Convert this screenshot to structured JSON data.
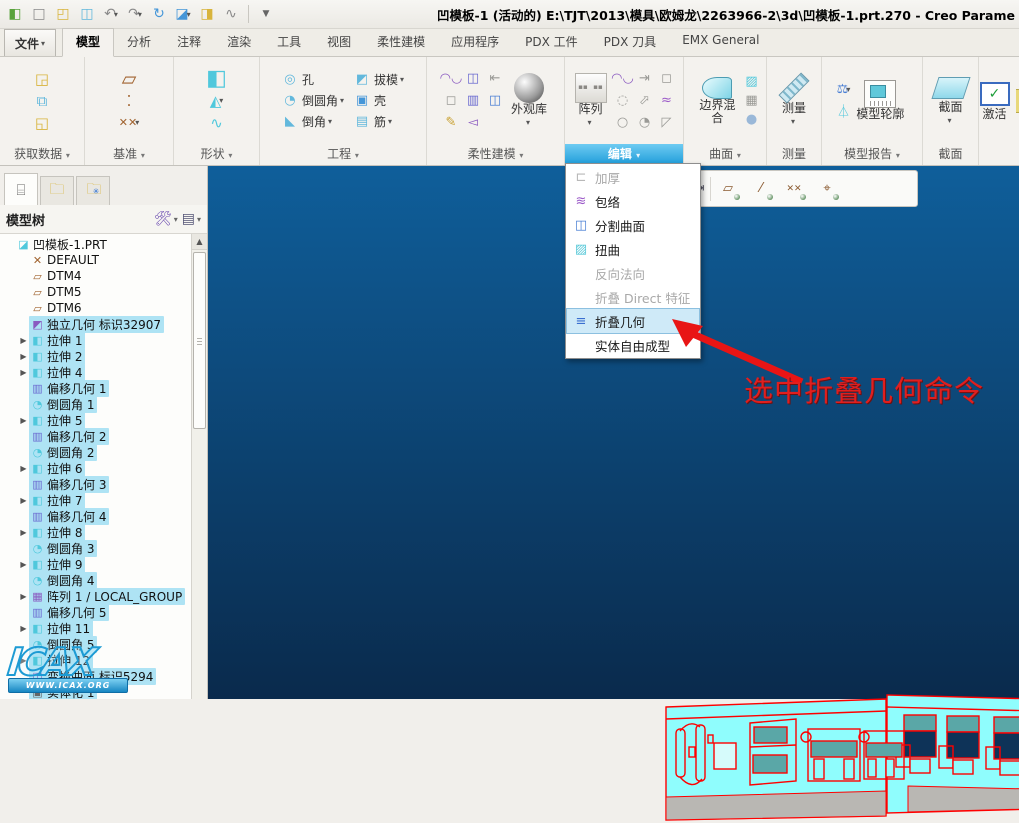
{
  "window": {
    "title": "凹模板-1 (活动的) E:\\TJT\\2013\\模具\\欧姆龙\\2263966-2\\3d\\凹模板-1.prt.270 - Creo Parame"
  },
  "quick_access": {
    "icons": [
      "window-icon",
      "new-file-icon",
      "open-icon",
      "save-icon",
      "undo-icon",
      "redo-icon",
      "regenerate-icon",
      "windows-icon",
      "close-window-icon",
      "resume-icon"
    ],
    "customize_arrow": "▼"
  },
  "tabs": {
    "file_label": "文件",
    "items": [
      "模型",
      "分析",
      "注释",
      "渲染",
      "工具",
      "视图",
      "柔性建模",
      "应用程序",
      "PDX 工件",
      "PDX 刀具",
      "EMX General"
    ],
    "active": "模型"
  },
  "ribbon": {
    "groups": {
      "get_data": {
        "label": "获取数据"
      },
      "datum": {
        "label": "基准"
      },
      "shapes": {
        "label": "形状"
      },
      "engineering": {
        "label": "工程",
        "hole": "孔",
        "round": "倒圆角",
        "chamfer": "倒角",
        "draft": "拔模",
        "shell": "壳",
        "rib": "筋"
      },
      "flexible": {
        "label": "柔性建模",
        "appearance": "外观库"
      },
      "edit": {
        "label": "编辑",
        "pattern": "阵列"
      },
      "surfaces": {
        "label": "曲面",
        "boundary_blend": "边界混合"
      },
      "measure": {
        "label": "测量",
        "button": "测量"
      },
      "model_report": {
        "label": "模型报告",
        "model_outline": "模型轮廓"
      },
      "section": {
        "label": "截面",
        "button": "截面"
      },
      "activate": {
        "label": "激活"
      }
    }
  },
  "edit_menu": {
    "items": [
      {
        "label": "加厚",
        "icon": "thicken-icon",
        "glyph": "⊏",
        "cls": "mi-thicken",
        "disabled": true
      },
      {
        "label": "包络",
        "icon": "wrap-icon",
        "glyph": "≋",
        "cls": "mi-wrap"
      },
      {
        "label": "分割曲面",
        "icon": "divide-surface-icon",
        "glyph": "◫",
        "cls": "mi-divide"
      },
      {
        "label": "扭曲",
        "icon": "warp-icon",
        "glyph": "▨",
        "cls": "mi-warp"
      },
      {
        "label": "反向法向",
        "disabled": true
      },
      {
        "label": "折叠 Direct 特征",
        "disabled": true
      },
      {
        "label": "折叠几何",
        "icon": "collapse-geometry-icon",
        "glyph": "≡",
        "cls": "mi-collapse",
        "highlighted": true
      },
      {
        "label": "实体自由成型"
      }
    ]
  },
  "graphics_toolbar": {
    "buttons": [
      "annotation-display-icon",
      "view-images-icon",
      "view-manager-icon",
      "saved-orientations-icon",
      "plane-display-icon",
      "axis-display-icon",
      "point-display-icon",
      "csys-display-icon"
    ]
  },
  "model_tree": {
    "title": "模型树",
    "panel_tabs": [
      "model-tree-tab",
      "folder-browser-tab",
      "favorites-tab"
    ],
    "items": [
      {
        "label": "凹模板-1.PRT",
        "icon": "part",
        "level": 0
      },
      {
        "label": "DEFAULT",
        "icon": "csys",
        "level": 1
      },
      {
        "label": "DTM4",
        "icon": "plane",
        "level": 1
      },
      {
        "label": "DTM5",
        "icon": "plane",
        "level": 1
      },
      {
        "label": "DTM6",
        "icon": "plane",
        "level": 1
      },
      {
        "label": "独立几何 标识32907",
        "icon": "copygeom",
        "level": 1,
        "selected": true
      },
      {
        "label": "拉伸 1",
        "icon": "extrude",
        "level": 1,
        "expand": true,
        "selected": true
      },
      {
        "label": "拉伸 2",
        "icon": "extrude",
        "level": 1,
        "expand": true,
        "selected": true
      },
      {
        "label": "拉伸 4",
        "icon": "extrude",
        "level": 1,
        "expand": true,
        "selected": true
      },
      {
        "label": "偏移几何 1",
        "icon": "offset",
        "level": 1,
        "selected": true
      },
      {
        "label": "倒圆角 1",
        "icon": "round",
        "level": 1,
        "selected": true
      },
      {
        "label": "拉伸 5",
        "icon": "extrude",
        "level": 1,
        "expand": true,
        "selected": true
      },
      {
        "label": "偏移几何 2",
        "icon": "offset",
        "level": 1,
        "selected": true
      },
      {
        "label": "倒圆角 2",
        "icon": "round",
        "level": 1,
        "selected": true
      },
      {
        "label": "拉伸 6",
        "icon": "extrude",
        "level": 1,
        "expand": true,
        "selected": true
      },
      {
        "label": "偏移几何 3",
        "icon": "offset",
        "level": 1,
        "selected": true
      },
      {
        "label": "拉伸 7",
        "icon": "extrude",
        "level": 1,
        "expand": true,
        "selected": true
      },
      {
        "label": "偏移几何 4",
        "icon": "offset",
        "level": 1,
        "selected": true
      },
      {
        "label": "拉伸 8",
        "icon": "extrude",
        "level": 1,
        "expand": true,
        "selected": true
      },
      {
        "label": "倒圆角 3",
        "icon": "round",
        "level": 1,
        "selected": true
      },
      {
        "label": "拉伸 9",
        "icon": "extrude",
        "level": 1,
        "expand": true,
        "selected": true
      },
      {
        "label": "倒圆角 4",
        "icon": "round",
        "level": 1,
        "selected": true
      },
      {
        "label": "阵列 1 / LOCAL_GROUP",
        "icon": "pattern",
        "level": 1,
        "expand": true,
        "selected": true
      },
      {
        "label": "偏移几何 5",
        "icon": "offset",
        "level": 1,
        "selected": true
      },
      {
        "label": "拉伸 11",
        "icon": "extrude",
        "level": 1,
        "expand": true,
        "selected": true
      },
      {
        "label": "倒圆角 5",
        "icon": "round",
        "level": 1,
        "selected": true
      },
      {
        "label": "拉伸 12",
        "icon": "extrude",
        "level": 1,
        "expand": true,
        "selected": true
      },
      {
        "label": "变换曲面 标识5294",
        "icon": "transform",
        "level": 1,
        "selected": true
      },
      {
        "label": "实体化 1",
        "icon": "solidify",
        "level": 1,
        "selected": true
      }
    ]
  },
  "annotation": {
    "text": "选中折叠几何命令"
  },
  "watermark": {
    "logo": "ICAX",
    "banner": "WWW.ICAX.ORG"
  },
  "colors": {
    "viewport_top": "#0f5f9b",
    "viewport_bottom": "#0a2a4c",
    "tree_selection": "#aee3f4",
    "edit_group_highlight": "#2aa4df",
    "annotation_red": "#e01f1f",
    "model_cyan": "#8ffdfd",
    "model_teal": "#5aa7a7",
    "model_gray": "#b9b7b3",
    "model_outline_red": "#ff0000"
  }
}
